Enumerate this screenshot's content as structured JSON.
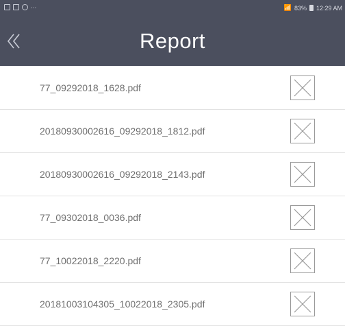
{
  "status_bar": {
    "notification_icons": [
      "image-icon",
      "gallery-icon",
      "at-icon"
    ],
    "more_indicator": "...",
    "battery_percent": "83%",
    "time": "12:29 AM"
  },
  "header": {
    "title": "Report",
    "back_icon": "chevron-left-icon"
  },
  "files": [
    {
      "name": "77_09292018_1628.pdf"
    },
    {
      "name": "20180930002616_09292018_1812.pdf"
    },
    {
      "name": "20180930002616_09292018_2143.pdf"
    },
    {
      "name": "77_09302018_0036.pdf"
    },
    {
      "name": "77_10022018_2220.pdf"
    },
    {
      "name": "20181003104305_10022018_2305.pdf"
    }
  ],
  "row_action_icon": "close-box-icon",
  "colors": {
    "app_bar": "#4b4f5e",
    "title_text": "#ffffff",
    "file_text": "#6f6f6f",
    "divider": "#e2e2e2",
    "icon_stroke": "#9a9a9a"
  }
}
